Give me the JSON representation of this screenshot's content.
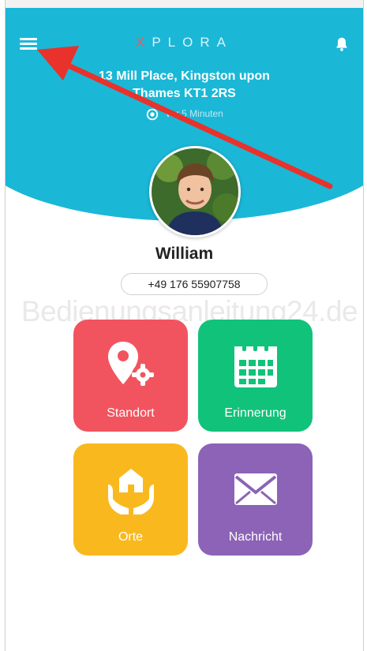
{
  "header": {
    "brand_x": "X",
    "brand_rest": "PLORA",
    "address_line1": "13 Mill Place, Kingston upon",
    "address_line2": "Thames KT1 2RS",
    "location_age": "vor 5 Minuten"
  },
  "profile": {
    "name": "William",
    "phone": "+49 176 55907758"
  },
  "tiles": [
    {
      "label": "Standort",
      "color": "#f2545f",
      "icon": "location-settings-icon"
    },
    {
      "label": "Erinnerung",
      "color": "#11c27a",
      "icon": "calendar-icon"
    },
    {
      "label": "Orte",
      "color": "#f9b91e",
      "icon": "home-hands-icon"
    },
    {
      "label": "Nachricht",
      "color": "#8c63b6",
      "icon": "envelope-icon"
    }
  ],
  "watermark": "Bedienungsanleitung24.de",
  "colors": {
    "header": "#1bb7d6",
    "arrow": "#e8322b"
  }
}
